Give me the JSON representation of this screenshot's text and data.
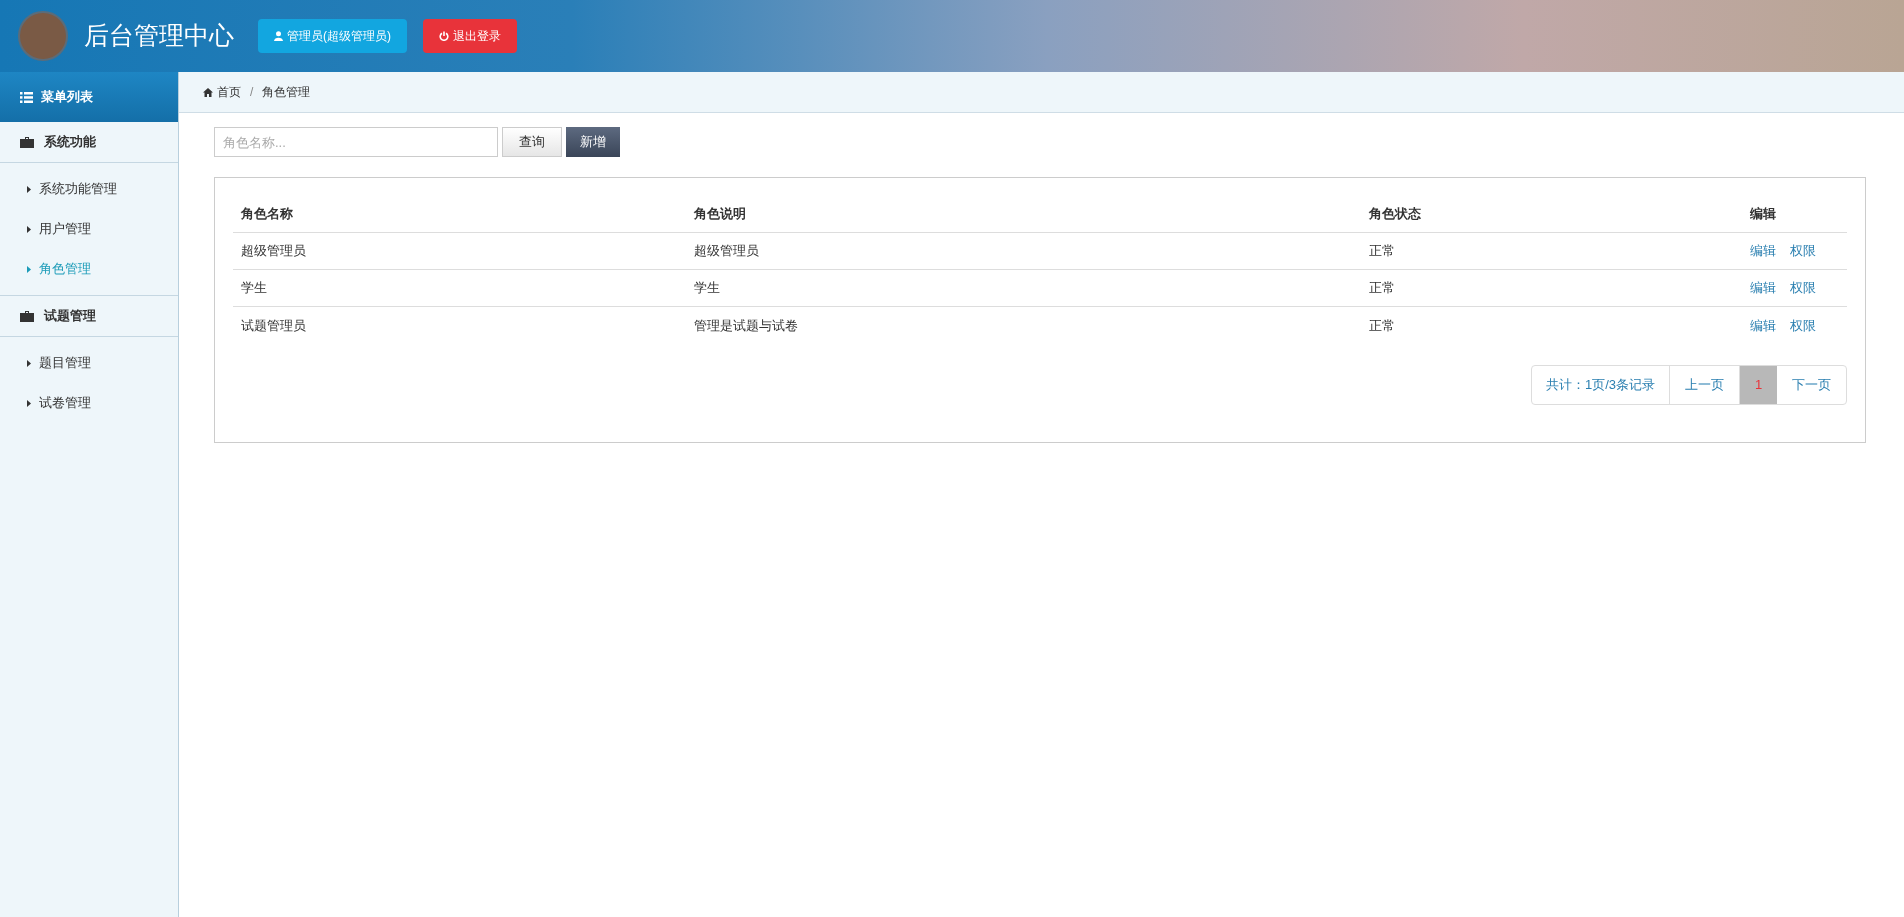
{
  "header": {
    "title": "后台管理中心",
    "user_button": "管理员(超级管理员)",
    "logout_button": "退出登录"
  },
  "sidebar": {
    "title": "菜单列表",
    "groups": [
      {
        "label": "系统功能",
        "children": [
          {
            "label": "系统功能管理",
            "selected": false
          },
          {
            "label": "用户管理",
            "selected": false
          },
          {
            "label": "角色管理",
            "selected": true
          }
        ]
      },
      {
        "label": "试题管理",
        "children": [
          {
            "label": "题目管理",
            "selected": false
          },
          {
            "label": "试卷管理",
            "selected": false
          }
        ]
      }
    ]
  },
  "breadcrumb": {
    "separator": "/",
    "items": [
      {
        "label": "首页"
      },
      {
        "label": "角色管理"
      }
    ]
  },
  "search": {
    "placeholder": "角色名称...",
    "query_button": "查询",
    "add_button": "新增"
  },
  "table": {
    "columns": [
      "角色名称",
      "角色说明",
      "角色状态",
      "编辑"
    ],
    "rows": [
      {
        "name": "超级管理员",
        "description": "超级管理员",
        "status": "正常",
        "actions": [
          "编辑",
          "权限"
        ]
      },
      {
        "name": "学生",
        "description": "学生",
        "status": "正常",
        "actions": [
          "编辑",
          "权限"
        ]
      },
      {
        "name": "试题管理员",
        "description": "管理是试题与试卷",
        "status": "正常",
        "actions": [
          "编辑",
          "权限"
        ]
      }
    ]
  },
  "pagination": {
    "summary": "共计：1页/3条记录",
    "prev": "上一页",
    "pages": [
      {
        "label": "1",
        "selected": true
      }
    ],
    "next": "下一页"
  }
}
